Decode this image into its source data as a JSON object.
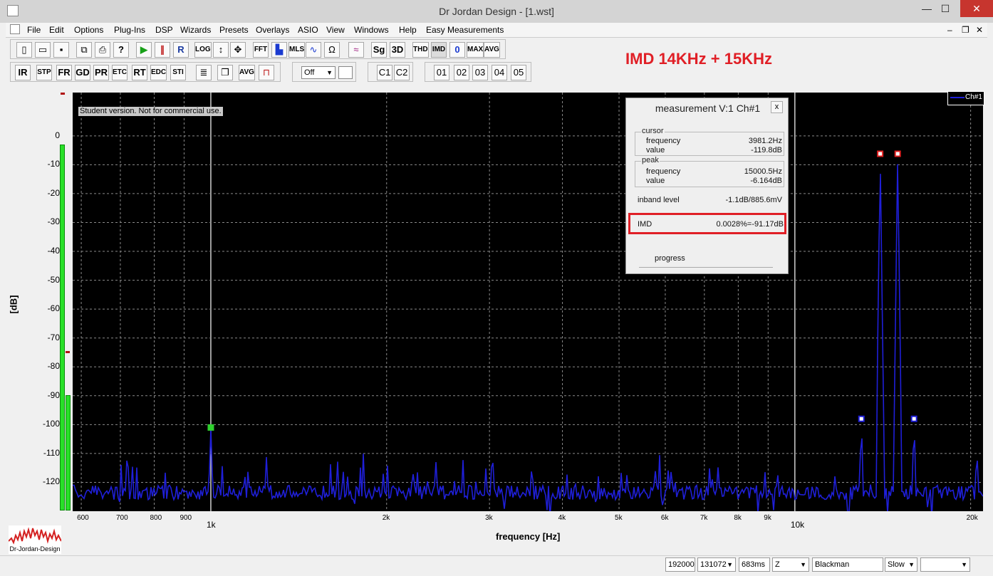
{
  "window": {
    "title": "Dr Jordan Design - [1.wst]",
    "minimize": "—",
    "maximize": "☐",
    "close": "✕"
  },
  "menu": [
    "File",
    "Edit",
    "Options",
    "Plug-Ins",
    "DSP",
    "Wizards",
    "Presets",
    "Overlays",
    "ASIO",
    "View",
    "Windows",
    "Help",
    "Easy Measurements"
  ],
  "toolbar1": [
    "LOG",
    "FFT",
    "MLS",
    "Sg",
    "3D",
    "THD",
    "IMD",
    "0",
    "MAX",
    "AVG",
    "R"
  ],
  "toolbar2": [
    "IR",
    "STP",
    "FR",
    "GD",
    "PR",
    "ETC",
    "RT",
    "EDC",
    "STI",
    "AVG"
  ],
  "channels": [
    "C1",
    "C2"
  ],
  "presets": [
    "01",
    "02",
    "03",
    "04",
    "05"
  ],
  "smoothing_select": "Off",
  "annotation": "IMD 14KHz + 15KHz",
  "watermark": "Student version. Not for commercial use.",
  "legend": "Ch#1",
  "y_axis": {
    "label": "[dB]",
    "ticks": [
      "0",
      "-10",
      "-20",
      "-30",
      "-40",
      "-50",
      "-60",
      "-70",
      "-80",
      "-90",
      "-100",
      "-110",
      "-120"
    ]
  },
  "x_axis": {
    "label": "frequency [Hz]",
    "ticks": [
      "600",
      "700",
      "800",
      "900",
      "1k",
      "2k",
      "3k",
      "4k",
      "5k",
      "6k",
      "7k",
      "8k",
      "9k",
      "10k",
      "20k"
    ]
  },
  "panel": {
    "title": "measurement V:1 Ch#1",
    "close": "x",
    "cursor": {
      "label": "cursor",
      "frequency_label": "frequency",
      "frequency": "3981.2Hz",
      "value_label": "value",
      "value": "-119.8dB"
    },
    "peak": {
      "label": "peak",
      "frequency_label": "frequency",
      "frequency": "15000.5Hz",
      "value_label": "value",
      "value": "-6.164dB"
    },
    "inband": {
      "label": "inband level",
      "value": "-1.1dB/885.6mV"
    },
    "imd": {
      "label": "IMD",
      "value": "0.0028%=-91.17dB"
    },
    "progress": "progress"
  },
  "status": {
    "samplerate": "192000",
    "fftsize": "131072",
    "time": "683ms",
    "weighting": "Z",
    "window": "Blackman",
    "speed": "Slow"
  },
  "logo_text": "Dr-Jordan-Design",
  "colors": {
    "trace": "#1f1fd8",
    "grid": "#8a8a8a",
    "accent": "#e01f26",
    "meter": "#28e028"
  },
  "chart_data": {
    "type": "line",
    "xlabel": "frequency [Hz]",
    "ylabel": "[dB]",
    "xscale": "log",
    "xlim": [
      580,
      21000
    ],
    "ylim": [
      -130,
      15
    ],
    "grid": true,
    "series": [
      {
        "name": "Ch#1",
        "x": [
          580,
          1000,
          13000,
          14000,
          15000,
          16000,
          20500
        ],
        "y": [
          -121,
          -101,
          -98,
          -6.2,
          -6.2,
          -98,
          -110
        ]
      }
    ],
    "markers": [
      {
        "x": 1000,
        "y": -101,
        "color": "green"
      },
      {
        "x": 13000,
        "y": -98,
        "color": "white"
      },
      {
        "x": 14000,
        "y": -6.2,
        "color": "red"
      },
      {
        "x": 15000,
        "y": -6.2,
        "color": "red"
      },
      {
        "x": 16000,
        "y": -98,
        "color": "white"
      }
    ]
  }
}
